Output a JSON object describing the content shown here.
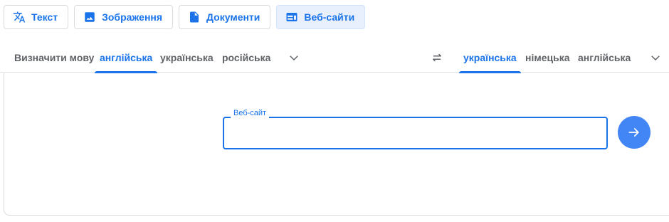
{
  "modes": [
    {
      "label": "Текст",
      "icon": "translate-icon"
    },
    {
      "label": "Зображення",
      "icon": "image-icon"
    },
    {
      "label": "Документи",
      "icon": "document-icon"
    },
    {
      "label": "Веб-сайти",
      "icon": "website-icon",
      "active": true
    }
  ],
  "source_langs": {
    "detect": "Визначити мову",
    "items": [
      "англійська",
      "українська",
      "російська"
    ],
    "selected": "англійська"
  },
  "target_langs": {
    "items": [
      "українська",
      "німецька",
      "англійська"
    ],
    "selected": "українська"
  },
  "website_input": {
    "label": "Веб-сайт",
    "value": ""
  },
  "colors": {
    "accent": "#1a73e8",
    "button": "#4285f4"
  }
}
